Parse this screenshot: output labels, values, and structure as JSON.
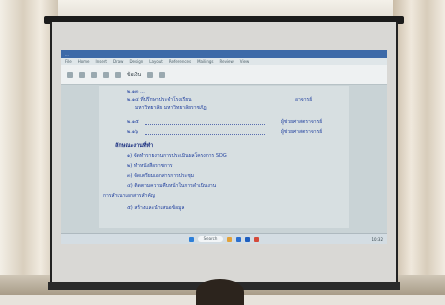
{
  "window": {
    "title": "...",
    "tabs": [
      "File",
      "Home",
      "Insert",
      "Draw",
      "Design",
      "Layout",
      "References",
      "Mailings",
      "Review",
      "View"
    ],
    "font_size_label": "ข้อเงิน"
  },
  "document": {
    "lines": [
      "๒.๑๓ ...",
      "๒.๑๔ ที่ปรึกษาประจำโรงเรียน",
      "มหาวิทยาลัย มหาวิทยาลัยราชภัฏ",
      "อาจารย์",
      "๒.๑๕",
      "ผู้ช่วยศาสตราจารย์",
      "๒.๑๖",
      "ผู้ช่วยศาสตราจารย์",
      "ลักษณะงานที่ทำ",
      "๑) จัดทำรายงานการประเมินผลโครงการ SDG",
      "๒) ทำหนังสือราชการ",
      "๓) จัดเตรียมเอกสารการประชุม",
      "๔) ติดตามความคืบหน้าในการดำเนินงาน",
      "การสำเนาเอกสารสำคัญ",
      "๕) สร้างและนำเสนอข้อมูล"
    ]
  },
  "taskbar": {
    "search_placeholder": "Search",
    "time": "10:32"
  },
  "colors": {
    "doc_text": "#1f3f9e",
    "titlebar": "#3d6aa8"
  }
}
